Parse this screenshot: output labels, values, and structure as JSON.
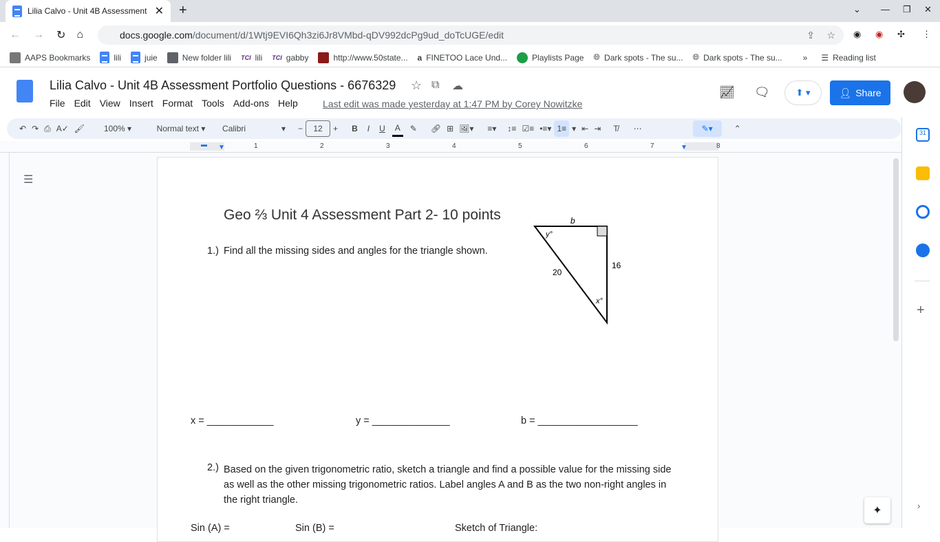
{
  "browser": {
    "tab_title": "Lilia Calvo - Unit 4B Assessment",
    "url_host": "docs.google.com",
    "url_path": "/document/d/1Wtj9EVI6Qh3zi6Jr8VMbd-qDV992dcPg9ud_doTcUGE/edit"
  },
  "bookmarks": [
    "AAPS Bookmarks",
    "lili",
    "juie",
    "New folder lili",
    "lili",
    "gabby",
    "http://www.50state...",
    "FINETOO Lace Und...",
    "Playlists Page",
    "Dark spots - The su...",
    "Dark spots - The su..."
  ],
  "reading_list": "Reading list",
  "doc": {
    "title": "Lilia Calvo - Unit 4B Assessment Portfolio Questions - 6676329",
    "menus": [
      "File",
      "Edit",
      "View",
      "Insert",
      "Format",
      "Tools",
      "Add-ons",
      "Help"
    ],
    "last_edit": "Last edit was made yesterday at 1:47 PM by Corey Nowitzke",
    "share": "Share"
  },
  "toolbar": {
    "zoom": "100%",
    "style": "Normal text",
    "font": "Calibri",
    "size": "12"
  },
  "ruler": [
    "1",
    "2",
    "3",
    "4",
    "5",
    "6",
    "7",
    "8"
  ],
  "content": {
    "heading": "Geo ⅔ Unit 4 Assessment Part 2- 10 points",
    "q1_num": "1.)",
    "q1": "Find all the missing sides and angles for the triangle shown.",
    "fig": {
      "b": "b",
      "y": "y°",
      "x": "x°",
      "hyp": "20",
      "leg": "16"
    },
    "x_blank": "x = ____________",
    "y_blank": "y = ______________",
    "b_blank": "b = __________________",
    "q2_num": "2.)",
    "q2": "Based on the given trigonometric ratio, sketch a triangle and find a possible value for the missing side as well as the other missing trigonometric ratios. Label angles A and B as the two non-right angles in the right triangle.",
    "sinA": "Sin (A) =",
    "sinB": "Sin (B) =",
    "sketch": "Sketch of Triangle:"
  }
}
